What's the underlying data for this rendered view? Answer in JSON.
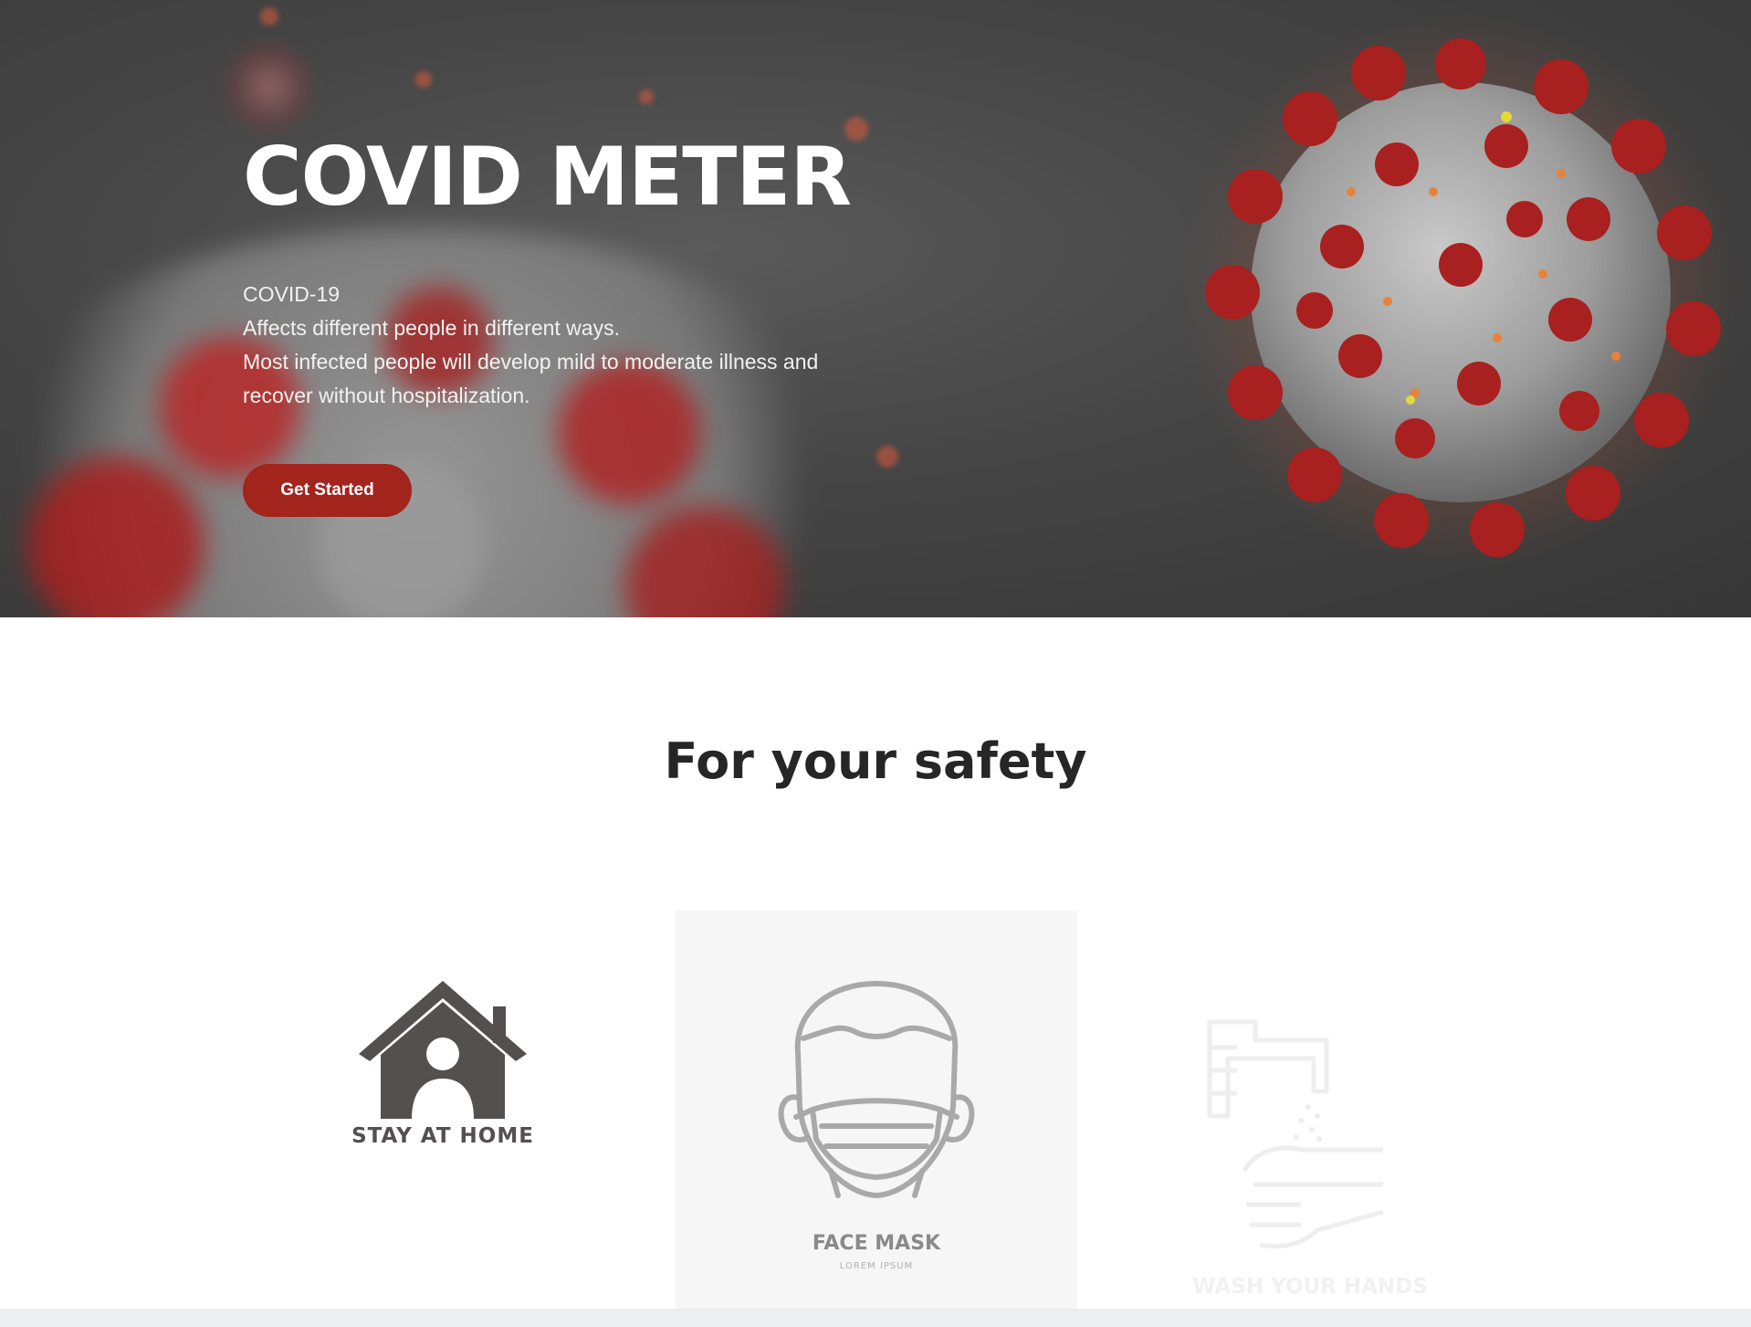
{
  "hero": {
    "title": "COVID METER",
    "lines": [
      "COVID-19",
      "Affects different people in different ways.",
      "Most infected people will develop mild to moderate illness and",
      "recover without hospitalization."
    ],
    "cta_label": "Get Started",
    "accent_color": "#a3231d",
    "background_color": "#454545"
  },
  "safety": {
    "title": "For your safety",
    "cards": [
      {
        "label": "STAY AT HOME",
        "icon": "house-person-icon"
      },
      {
        "label": "FACE MASK",
        "sublabel": "LOREM IPSUM",
        "icon": "face-mask-icon"
      },
      {
        "label": "WASH YOUR HANDS",
        "icon": "hand-wash-icon"
      }
    ]
  },
  "colors": {
    "title_text": "#262626",
    "home_icon": "#545050",
    "mask_icon": "#a9a9a9",
    "footer_bar": "#eceef0"
  }
}
